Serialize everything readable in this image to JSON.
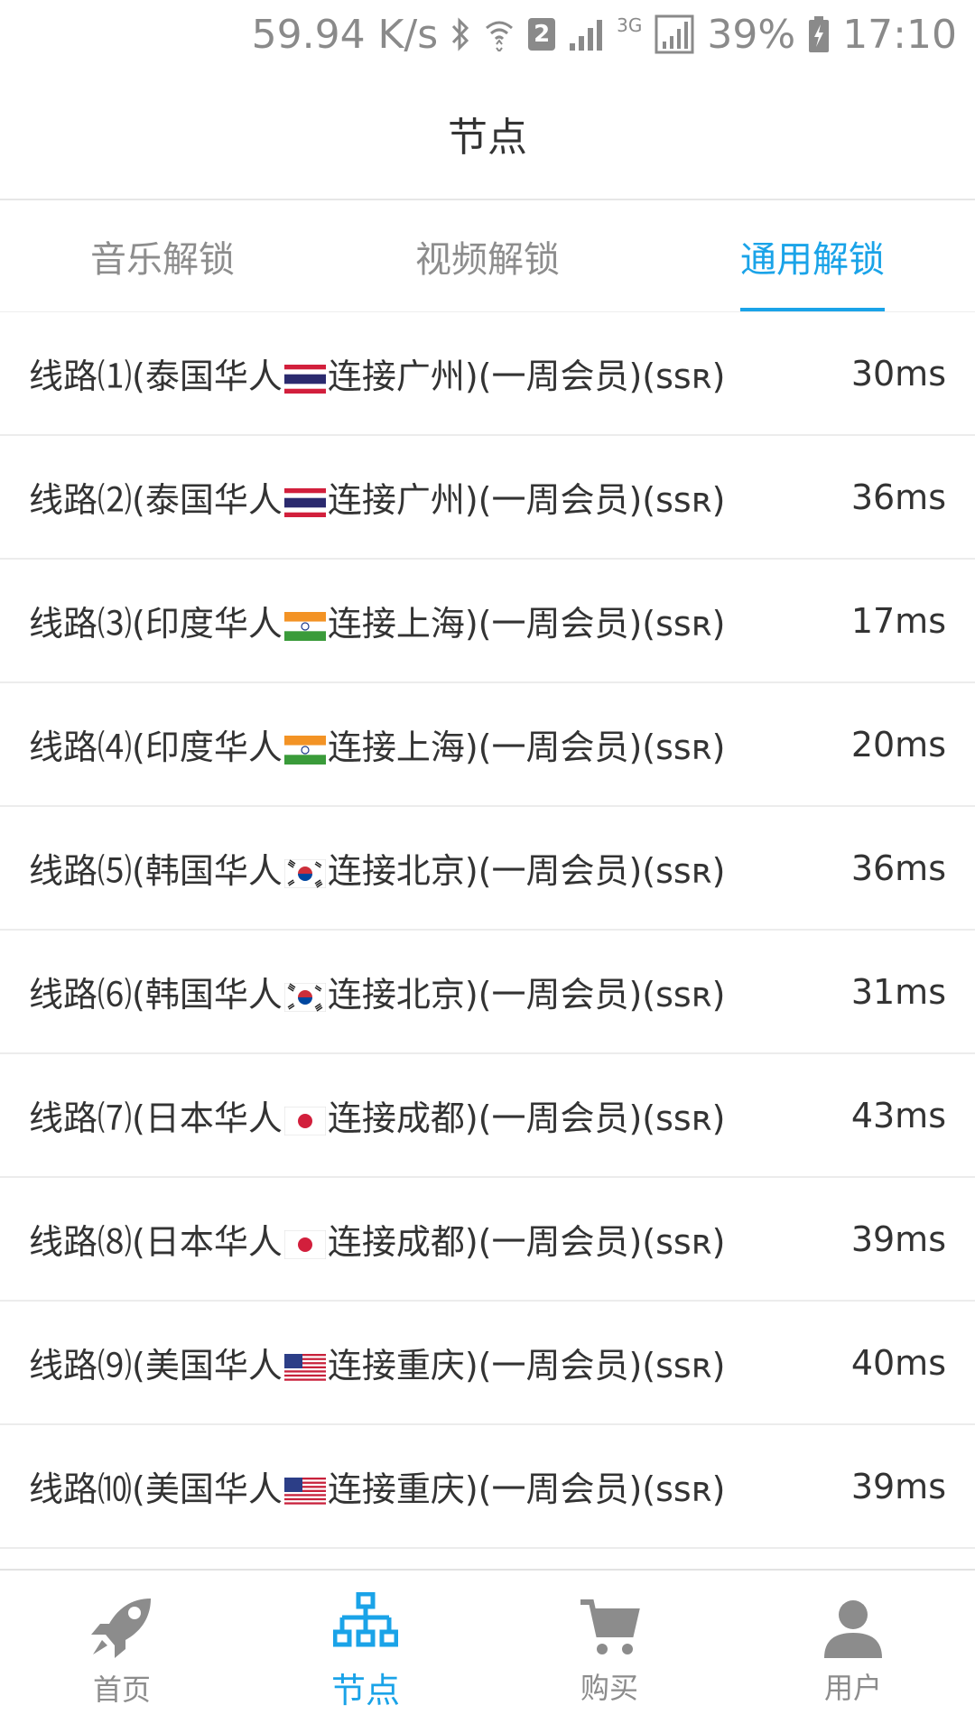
{
  "status_bar": {
    "net_speed": "59.94 K/s",
    "sim_slot": "2",
    "network_type": "3G",
    "battery": "39%",
    "time": "17:10"
  },
  "header": {
    "title": "节点"
  },
  "tabs": [
    {
      "label": "音乐解锁",
      "active": false
    },
    {
      "label": "视频解锁",
      "active": false
    },
    {
      "label": "通用解锁",
      "active": true
    }
  ],
  "nodes": [
    {
      "prefix": "线路⑴(泰国华人",
      "flag": "thailand",
      "suffix": "连接广州)(一周会员)(ssʀ)",
      "ping": "30ms"
    },
    {
      "prefix": "线路⑵(泰国华人",
      "flag": "thailand",
      "suffix": "连接广州)(一周会员)(ssʀ)",
      "ping": "36ms"
    },
    {
      "prefix": "线路⑶(印度华人",
      "flag": "india",
      "suffix": "连接上海)(一周会员)(ssʀ)",
      "ping": "17ms"
    },
    {
      "prefix": "线路⑷(印度华人",
      "flag": "india",
      "suffix": "连接上海)(一周会员)(ssʀ)",
      "ping": "20ms"
    },
    {
      "prefix": "线路⑸(韩国华人",
      "flag": "korea",
      "suffix": "连接北京)(一周会员)(ssʀ)",
      "ping": "36ms"
    },
    {
      "prefix": "线路⑹(韩国华人",
      "flag": "korea",
      "suffix": "连接北京)(一周会员)(ssʀ)",
      "ping": "31ms"
    },
    {
      "prefix": "线路⑺(日本华人",
      "flag": "japan",
      "suffix": "连接成都)(一周会员)(ssʀ)",
      "ping": "43ms"
    },
    {
      "prefix": "线路⑻(日本华人",
      "flag": "japan",
      "suffix": "连接成都)(一周会员)(ssʀ)",
      "ping": "39ms"
    },
    {
      "prefix": "线路⑼(美国华人",
      "flag": "usa",
      "suffix": "连接重庆)(一周会员)(ssʀ)",
      "ping": "40ms"
    },
    {
      "prefix": "线路⑽(美国华人",
      "flag": "usa",
      "suffix": "连接重庆)(一周会员)(ssʀ)",
      "ping": "39ms"
    }
  ],
  "bottom_nav": [
    {
      "label": "首页",
      "icon": "rocket-icon",
      "active": false
    },
    {
      "label": "节点",
      "icon": "network-tree-icon",
      "active": true
    },
    {
      "label": "购买",
      "icon": "cart-icon",
      "active": false
    },
    {
      "label": "用户",
      "icon": "user-icon",
      "active": false
    }
  ],
  "colors": {
    "accent": "#1aa3e8",
    "inactive": "#8c8c8c",
    "text": "#333333"
  }
}
